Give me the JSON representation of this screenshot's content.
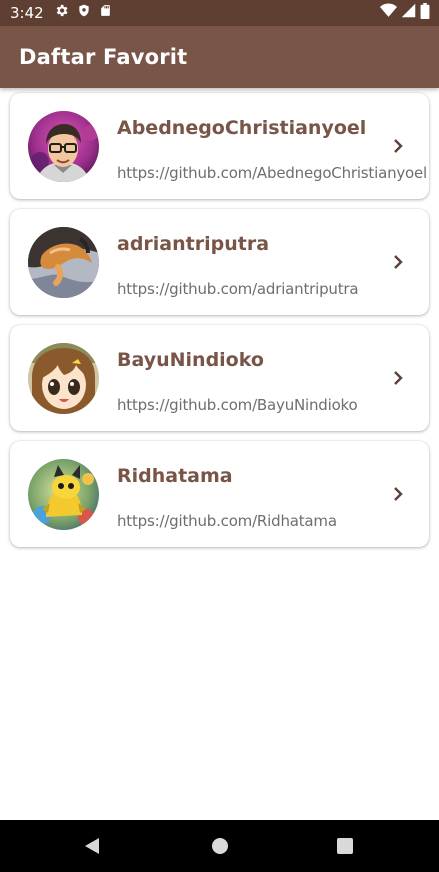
{
  "status_bar": {
    "time": "3:42",
    "icons_left": [
      "gear-icon",
      "shield-icon",
      "sd-card-icon"
    ],
    "icons_right": [
      "wifi-icon",
      "signal-icon",
      "battery-icon"
    ]
  },
  "app_bar": {
    "title": "Daftar Favorit",
    "color": "#795548",
    "status_color": "#5f3f32"
  },
  "favorites": [
    {
      "name": "AbednegoChristianyoel",
      "url": "https://github.com/AbednegoChristianyoel",
      "avatar": "cartoon-man-glasses-avatar"
    },
    {
      "name": "adriantriputra",
      "url": "https://github.com/adriantriputra",
      "avatar": "orange-cat-avatar"
    },
    {
      "name": "BayuNindioko",
      "url": "https://github.com/BayuNindioko",
      "avatar": "anime-girl-avatar"
    },
    {
      "name": "Ridhatama",
      "url": "https://github.com/Ridhatama",
      "avatar": "yellow-creature-game-art-avatar"
    }
  ],
  "nav_bar": {
    "buttons": [
      "back-icon",
      "home-icon",
      "recents-icon"
    ]
  }
}
